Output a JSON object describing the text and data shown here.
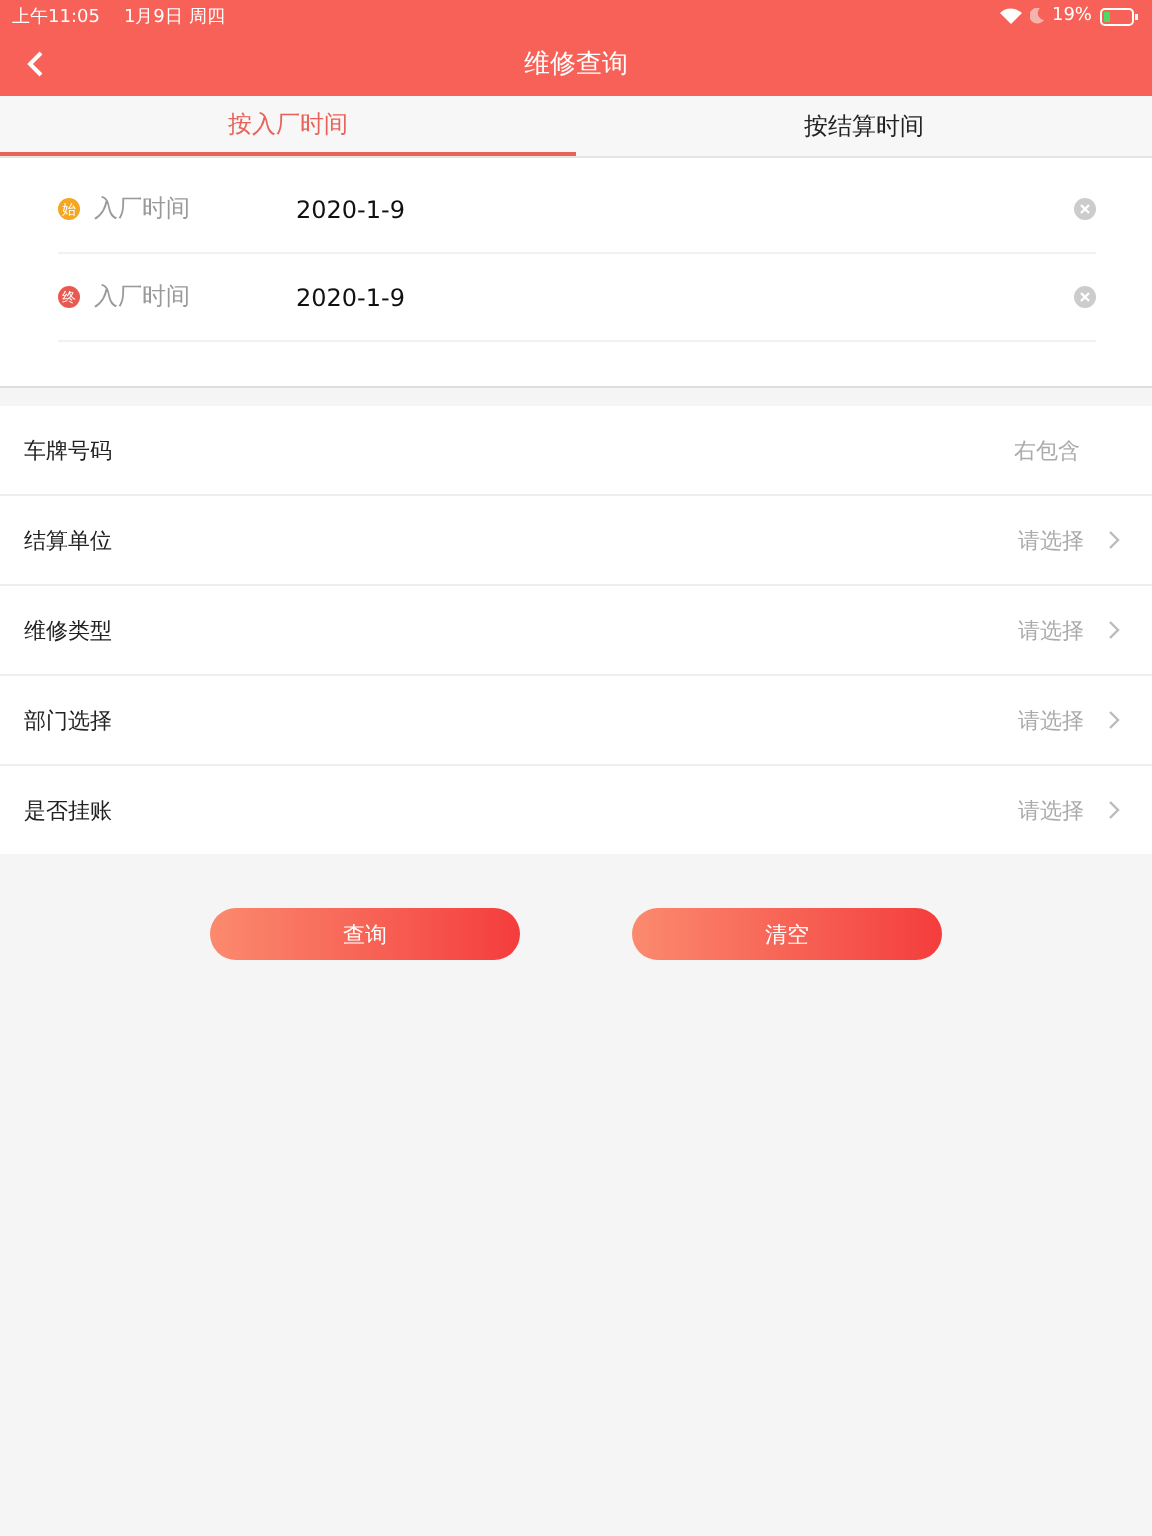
{
  "status_bar": {
    "time": "上午11:05",
    "date": "1月9日 周四",
    "battery": "19%"
  },
  "nav": {
    "title": "维修查询"
  },
  "tabs": [
    {
      "label": "按入厂时间",
      "selected": true
    },
    {
      "label": "按结算时间",
      "selected": false
    }
  ],
  "dates": [
    {
      "badge": "始",
      "color": "#f5a623",
      "label": "入厂时间",
      "value": "2020-1-9"
    },
    {
      "badge": "终",
      "color": "#e85a50",
      "label": "入厂时间",
      "value": "2020-1-9"
    }
  ],
  "fields": [
    {
      "kind": "input",
      "label": "车牌号码",
      "placeholder": "右包含"
    },
    {
      "kind": "select",
      "label": "结算单位",
      "placeholder": "请选择"
    },
    {
      "kind": "select",
      "label": "维修类型",
      "placeholder": "请选择"
    },
    {
      "kind": "select",
      "label": "部门选择",
      "placeholder": "请选择"
    },
    {
      "kind": "select",
      "label": "是否挂账",
      "placeholder": "请选择"
    }
  ],
  "buttons": [
    "查询",
    "清空"
  ]
}
